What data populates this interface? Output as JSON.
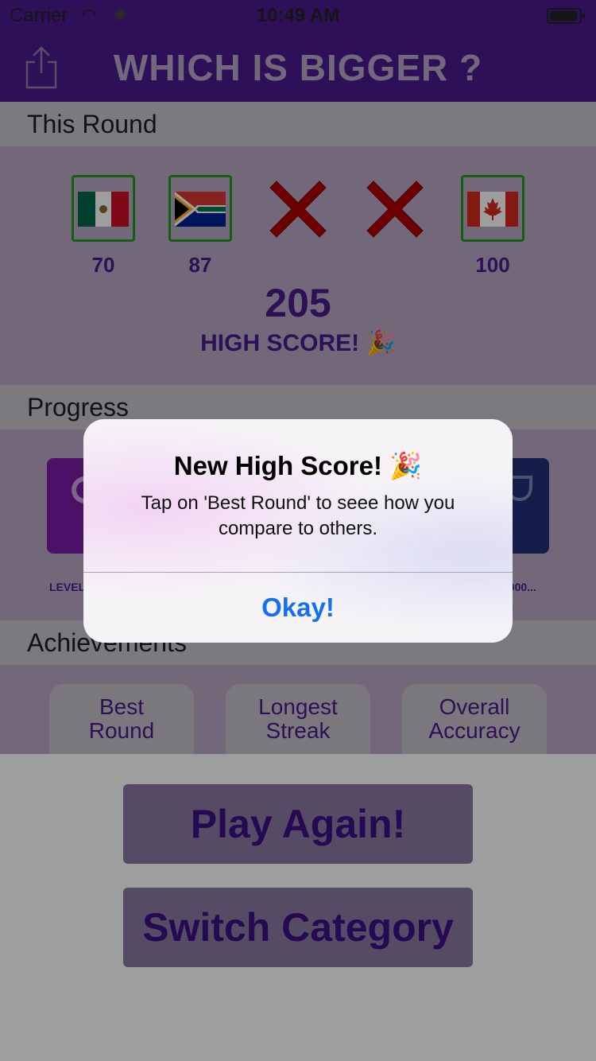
{
  "status_bar": {
    "carrier": "Carrier",
    "time": "10:49 AM"
  },
  "nav": {
    "title": "WHICH IS BIGGER ?"
  },
  "this_round": {
    "header": "This Round",
    "slots": [
      {
        "type": "flag",
        "country_flag": "mexico-flag",
        "score": "70"
      },
      {
        "type": "flag",
        "country_flag": "south-africa-flag",
        "score": "87"
      },
      {
        "type": "miss",
        "score": ""
      },
      {
        "type": "miss",
        "score": ""
      },
      {
        "type": "flag",
        "country_flag": "canada-flag",
        "score": "100"
      }
    ],
    "total": "205",
    "high_score_label": "HIGH SCORE! 🎉"
  },
  "progress": {
    "header": "Progress",
    "left_caption": "LEVEL",
    "right_caption": "0000..."
  },
  "achievements": {
    "header": "Achievements",
    "tiles": [
      {
        "line1": "Best",
        "line2": "Round"
      },
      {
        "line1": "Longest",
        "line2": "Streak"
      },
      {
        "line1": "Overall",
        "line2": "Accuracy"
      }
    ]
  },
  "buttons": {
    "play_again": "Play Again!",
    "switch_category": "Switch Category"
  },
  "alert": {
    "title": "New High Score! 🎉",
    "message": "Tap on 'Best Round' to seee how you compare to others.",
    "button": "Okay!"
  },
  "colors": {
    "nav_purple": "#4b1a8e",
    "accent_purple": "#4a1b8c",
    "correct_green": "#1f9c1f",
    "miss_red": "#b10000",
    "ios_blue": "#1470f0"
  }
}
